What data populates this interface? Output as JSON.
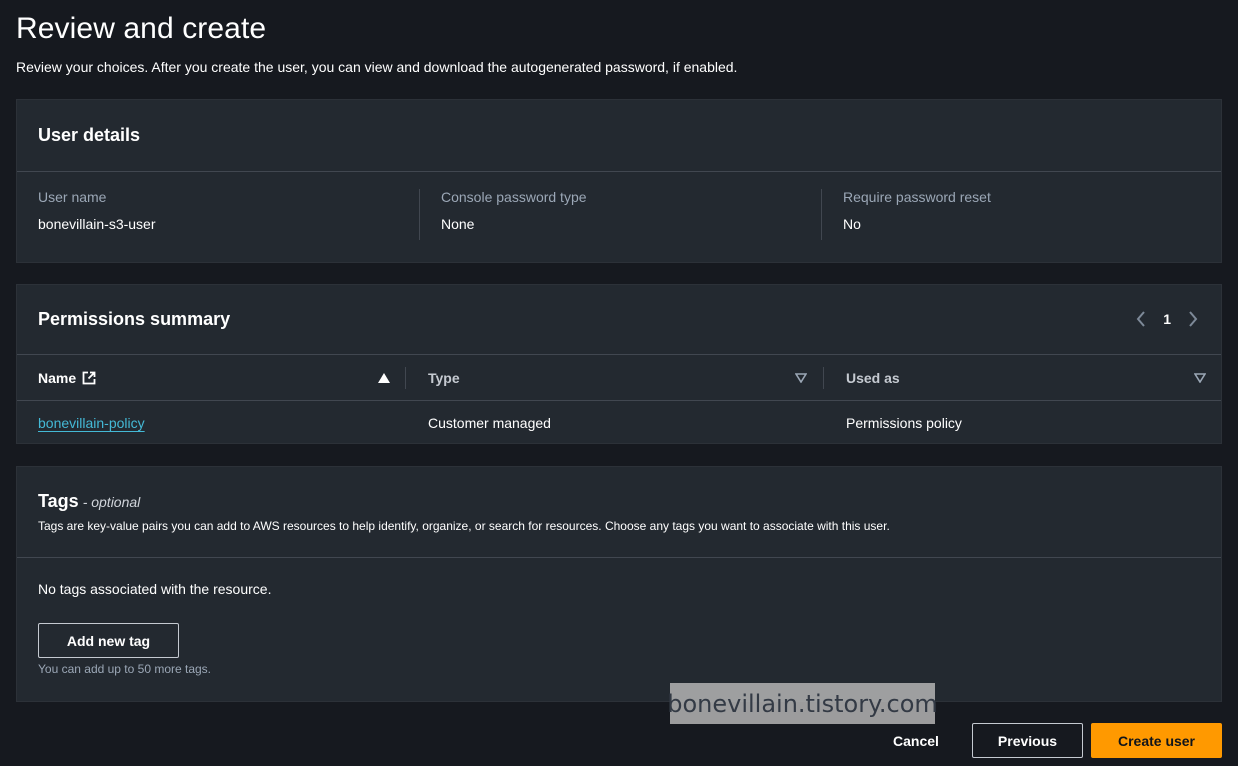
{
  "page": {
    "title": "Review and create",
    "description": "Review your choices. After you create the user, you can view and download the autogenerated password, if enabled."
  },
  "user_details": {
    "title": "User details",
    "fields": [
      {
        "label": "User name",
        "value": "bonevillain-s3-user"
      },
      {
        "label": "Console password type",
        "value": "None"
      },
      {
        "label": "Require password reset",
        "value": "No"
      }
    ]
  },
  "permissions": {
    "title": "Permissions summary",
    "page": "1",
    "columns": [
      "Name",
      "Type",
      "Used as"
    ],
    "rows": [
      {
        "name": "bonevillain-policy",
        "type": "Customer managed",
        "used_as": "Permissions policy"
      }
    ]
  },
  "tags": {
    "title": "Tags",
    "optional": "- optional",
    "description": "Tags are key-value pairs you can add to AWS resources to help identify, organize, or search for resources. Choose any tags you want to associate with this user.",
    "empty": "No tags associated with the resource.",
    "add_button": "Add new tag",
    "hint": "You can add up to 50 more tags."
  },
  "watermark": "bonevillain.tistory.com",
  "footer": {
    "cancel": "Cancel",
    "previous": "Previous",
    "create": "Create user"
  },
  "colors": {
    "background": "#16191f",
    "card": "#232930",
    "link": "#44b9d6",
    "primary": "#ff9900"
  },
  "icons": [
    "external-link-icon",
    "sort-ascending-icon",
    "sort-descending-icon",
    "chevron-left-icon",
    "chevron-right-icon"
  ]
}
